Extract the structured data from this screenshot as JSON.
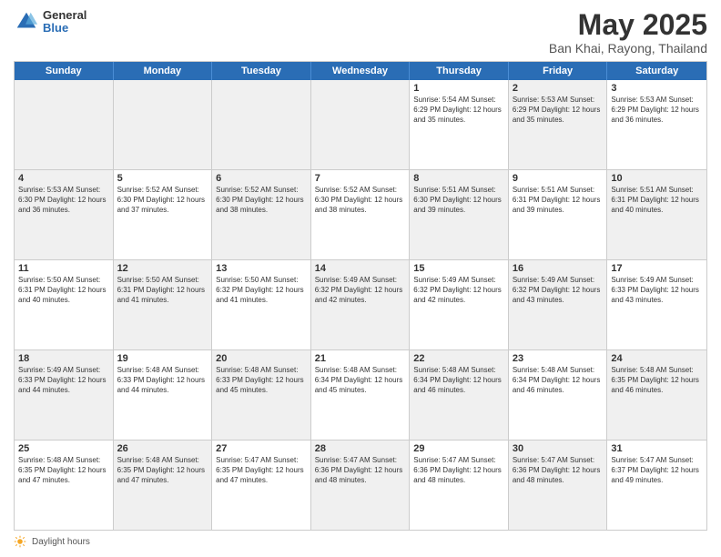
{
  "header": {
    "logo_general": "General",
    "logo_blue": "Blue",
    "main_title": "May 2025",
    "subtitle": "Ban Khai, Rayong, Thailand"
  },
  "weekdays": [
    "Sunday",
    "Monday",
    "Tuesday",
    "Wednesday",
    "Thursday",
    "Friday",
    "Saturday"
  ],
  "footer": {
    "label": "Daylight hours"
  },
  "weeks": [
    [
      {
        "day": "",
        "info": "",
        "shaded": true
      },
      {
        "day": "",
        "info": "",
        "shaded": true
      },
      {
        "day": "",
        "info": "",
        "shaded": true
      },
      {
        "day": "",
        "info": "",
        "shaded": true
      },
      {
        "day": "1",
        "info": "Sunrise: 5:54 AM\nSunset: 6:29 PM\nDaylight: 12 hours\nand 35 minutes."
      },
      {
        "day": "2",
        "info": "Sunrise: 5:53 AM\nSunset: 6:29 PM\nDaylight: 12 hours\nand 35 minutes.",
        "shaded": true
      },
      {
        "day": "3",
        "info": "Sunrise: 5:53 AM\nSunset: 6:29 PM\nDaylight: 12 hours\nand 36 minutes."
      }
    ],
    [
      {
        "day": "4",
        "info": "Sunrise: 5:53 AM\nSunset: 6:30 PM\nDaylight: 12 hours\nand 36 minutes.",
        "shaded": true
      },
      {
        "day": "5",
        "info": "Sunrise: 5:52 AM\nSunset: 6:30 PM\nDaylight: 12 hours\nand 37 minutes."
      },
      {
        "day": "6",
        "info": "Sunrise: 5:52 AM\nSunset: 6:30 PM\nDaylight: 12 hours\nand 38 minutes.",
        "shaded": true
      },
      {
        "day": "7",
        "info": "Sunrise: 5:52 AM\nSunset: 6:30 PM\nDaylight: 12 hours\nand 38 minutes."
      },
      {
        "day": "8",
        "info": "Sunrise: 5:51 AM\nSunset: 6:30 PM\nDaylight: 12 hours\nand 39 minutes.",
        "shaded": true
      },
      {
        "day": "9",
        "info": "Sunrise: 5:51 AM\nSunset: 6:31 PM\nDaylight: 12 hours\nand 39 minutes."
      },
      {
        "day": "10",
        "info": "Sunrise: 5:51 AM\nSunset: 6:31 PM\nDaylight: 12 hours\nand 40 minutes.",
        "shaded": true
      }
    ],
    [
      {
        "day": "11",
        "info": "Sunrise: 5:50 AM\nSunset: 6:31 PM\nDaylight: 12 hours\nand 40 minutes."
      },
      {
        "day": "12",
        "info": "Sunrise: 5:50 AM\nSunset: 6:31 PM\nDaylight: 12 hours\nand 41 minutes.",
        "shaded": true
      },
      {
        "day": "13",
        "info": "Sunrise: 5:50 AM\nSunset: 6:32 PM\nDaylight: 12 hours\nand 41 minutes."
      },
      {
        "day": "14",
        "info": "Sunrise: 5:49 AM\nSunset: 6:32 PM\nDaylight: 12 hours\nand 42 minutes.",
        "shaded": true
      },
      {
        "day": "15",
        "info": "Sunrise: 5:49 AM\nSunset: 6:32 PM\nDaylight: 12 hours\nand 42 minutes."
      },
      {
        "day": "16",
        "info": "Sunrise: 5:49 AM\nSunset: 6:32 PM\nDaylight: 12 hours\nand 43 minutes.",
        "shaded": true
      },
      {
        "day": "17",
        "info": "Sunrise: 5:49 AM\nSunset: 6:33 PM\nDaylight: 12 hours\nand 43 minutes."
      }
    ],
    [
      {
        "day": "18",
        "info": "Sunrise: 5:49 AM\nSunset: 6:33 PM\nDaylight: 12 hours\nand 44 minutes.",
        "shaded": true
      },
      {
        "day": "19",
        "info": "Sunrise: 5:48 AM\nSunset: 6:33 PM\nDaylight: 12 hours\nand 44 minutes."
      },
      {
        "day": "20",
        "info": "Sunrise: 5:48 AM\nSunset: 6:33 PM\nDaylight: 12 hours\nand 45 minutes.",
        "shaded": true
      },
      {
        "day": "21",
        "info": "Sunrise: 5:48 AM\nSunset: 6:34 PM\nDaylight: 12 hours\nand 45 minutes."
      },
      {
        "day": "22",
        "info": "Sunrise: 5:48 AM\nSunset: 6:34 PM\nDaylight: 12 hours\nand 46 minutes.",
        "shaded": true
      },
      {
        "day": "23",
        "info": "Sunrise: 5:48 AM\nSunset: 6:34 PM\nDaylight: 12 hours\nand 46 minutes."
      },
      {
        "day": "24",
        "info": "Sunrise: 5:48 AM\nSunset: 6:35 PM\nDaylight: 12 hours\nand 46 minutes.",
        "shaded": true
      }
    ],
    [
      {
        "day": "25",
        "info": "Sunrise: 5:48 AM\nSunset: 6:35 PM\nDaylight: 12 hours\nand 47 minutes."
      },
      {
        "day": "26",
        "info": "Sunrise: 5:48 AM\nSunset: 6:35 PM\nDaylight: 12 hours\nand 47 minutes.",
        "shaded": true
      },
      {
        "day": "27",
        "info": "Sunrise: 5:47 AM\nSunset: 6:35 PM\nDaylight: 12 hours\nand 47 minutes."
      },
      {
        "day": "28",
        "info": "Sunrise: 5:47 AM\nSunset: 6:36 PM\nDaylight: 12 hours\nand 48 minutes.",
        "shaded": true
      },
      {
        "day": "29",
        "info": "Sunrise: 5:47 AM\nSunset: 6:36 PM\nDaylight: 12 hours\nand 48 minutes."
      },
      {
        "day": "30",
        "info": "Sunrise: 5:47 AM\nSunset: 6:36 PM\nDaylight: 12 hours\nand 48 minutes.",
        "shaded": true
      },
      {
        "day": "31",
        "info": "Sunrise: 5:47 AM\nSunset: 6:37 PM\nDaylight: 12 hours\nand 49 minutes."
      }
    ]
  ]
}
